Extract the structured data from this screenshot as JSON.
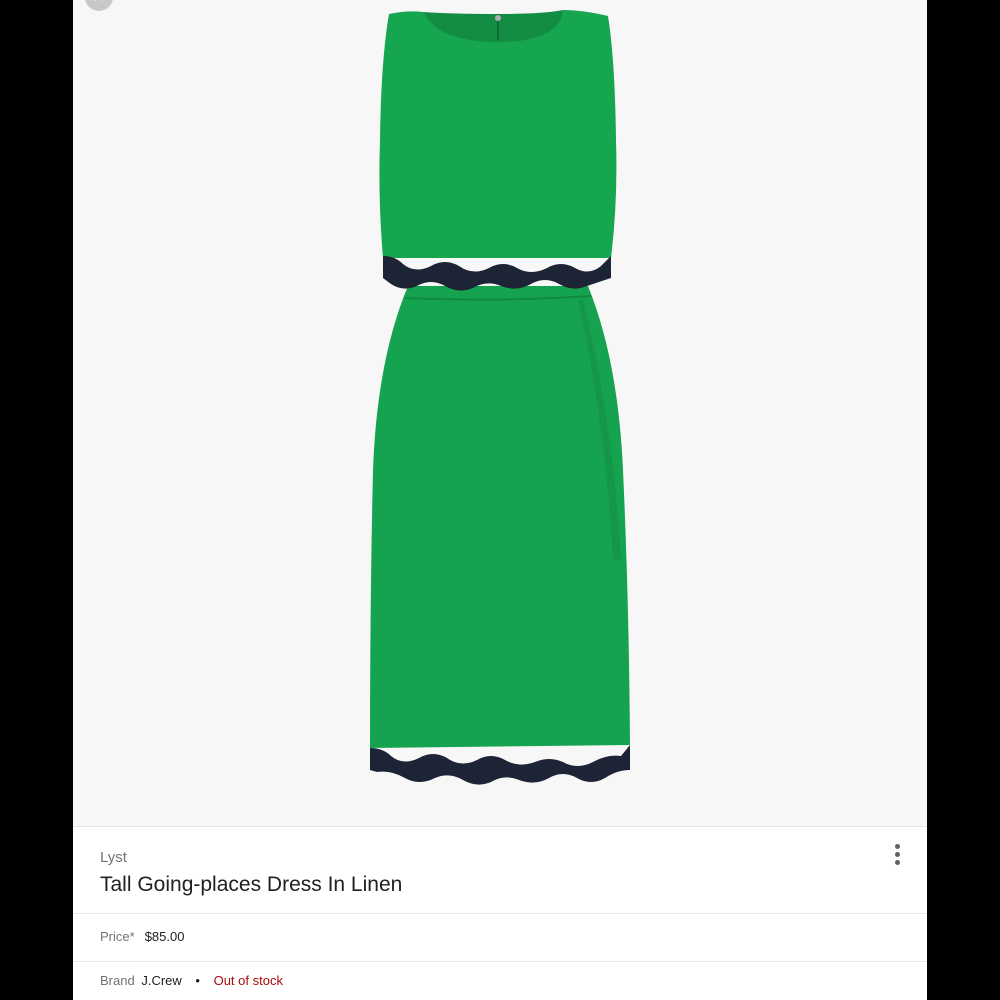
{
  "close": {
    "icon": "close-icon",
    "glyph": "×"
  },
  "product": {
    "image_alt": "green linen dress with navy scalloped trim",
    "colors": {
      "dress": "#16a34f",
      "trim": "#1d2436",
      "background": "#f7f7f7"
    },
    "source": "Lyst",
    "title": "Tall Going-places Dress In Linen",
    "more_icon": "more-vert-icon",
    "price_label": "Price*",
    "price_value": "$85.00",
    "brand_label": "Brand",
    "brand_value": "J.Crew",
    "separator": "•",
    "stock_status": "Out of stock",
    "stock_color": "#a50e0e"
  }
}
